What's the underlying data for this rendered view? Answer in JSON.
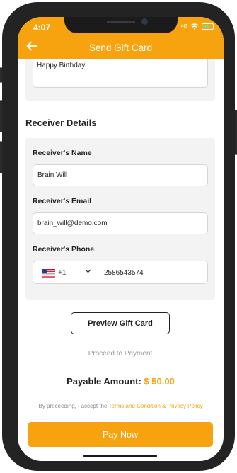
{
  "status_bar": {
    "time": "4:07",
    "signal": "4G"
  },
  "header": {
    "title": "Send Gift Card",
    "back_icon": "arrow-left-icon"
  },
  "message": {
    "text": "Happy Birthday"
  },
  "receiver": {
    "section_title": "Receiver Details",
    "name_label": "Receiver's Name",
    "name_value": "Brain Will",
    "email_label": "Receiver's Email",
    "email_value": "brain_will@demo.com",
    "phone_label": "Receiver's Phone",
    "country_code": "+1",
    "phone_value": "2586543574"
  },
  "preview_button": "Preview Gift Card",
  "proceed_text": "Proceed to Payment",
  "payable": {
    "label": "Payable Amount:",
    "amount": "$ 50.00"
  },
  "terms": {
    "prefix": "By proceeding, I accept the",
    "link": "Terms and Condition & Privacy Policy"
  },
  "pay_button": "Pay Now",
  "colors": {
    "accent": "#f7a30f",
    "card_bg": "#f3f3f3"
  }
}
